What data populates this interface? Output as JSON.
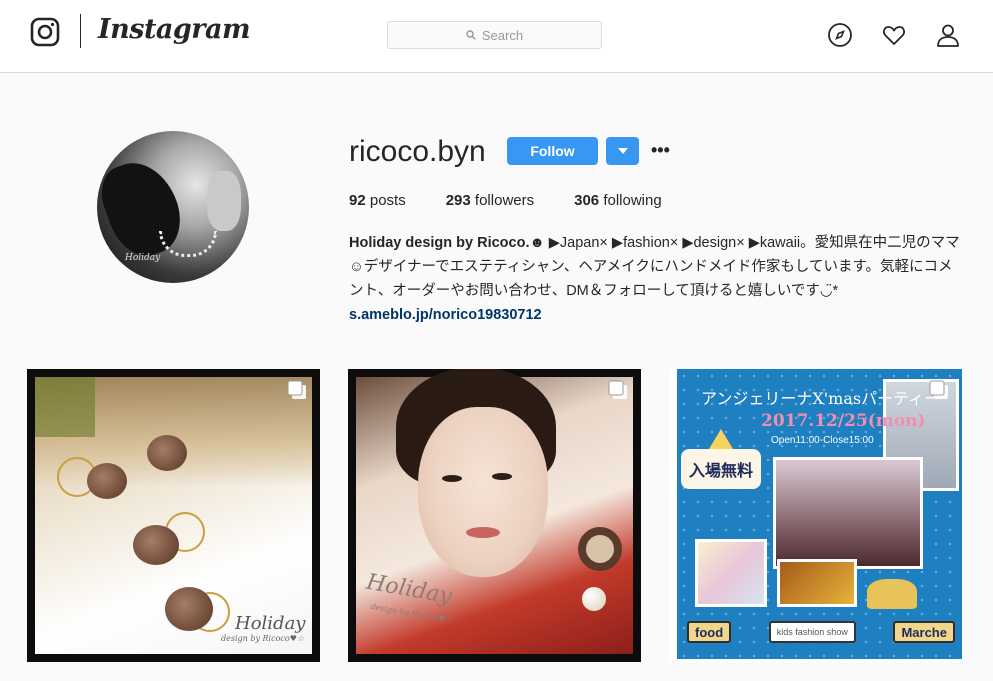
{
  "header": {
    "wordmark": "Instagram",
    "search_placeholder": "Search",
    "icons": [
      "instagram-glyph-icon",
      "search-icon",
      "compass-icon",
      "heart-icon",
      "user-icon"
    ]
  },
  "profile": {
    "username": "ricoco.byn",
    "follow_label": "Follow",
    "more_label": "•••",
    "avatar_signature": "Holiday",
    "stats": {
      "posts_count": "92",
      "posts_label": "posts",
      "followers_count": "293",
      "followers_label": "followers",
      "following_count": "306",
      "following_label": "following"
    },
    "bio": {
      "name": "Holiday design by Ricoco.☻",
      "text": " ▶Japan× ▶fashion× ▶design× ▶kawaii。愛知県在中二児のママ☺デザイナーでエステティシャン、ヘアメイクにハンドメイド作家もしています。気軽にコメント、オーダーやお問い合わせ、DM＆フォローして頂けると嬉しいです◡̈* ",
      "link": "s.ameblo.jp/norico19830712"
    }
  },
  "posts": [
    {
      "caption": "Holiday",
      "subcaption": "design by Ricoco♥☆",
      "multi": true
    },
    {
      "caption": "Holiday",
      "subcaption": "design by Ricoco♥☆",
      "multi": true
    },
    {
      "title": "アンジェリーナX'masパーティー",
      "date": "2017.12/25(mon)",
      "time": "Open11:00-Close15:00",
      "badge": "入場無料",
      "tags": [
        "food",
        "kids fashion show",
        "Marche"
      ],
      "multi": true
    }
  ],
  "colors": {
    "accent": "#3897f0",
    "link": "#003569",
    "text": "#262626",
    "border": "#dbdbdb",
    "background": "#fafafa"
  }
}
